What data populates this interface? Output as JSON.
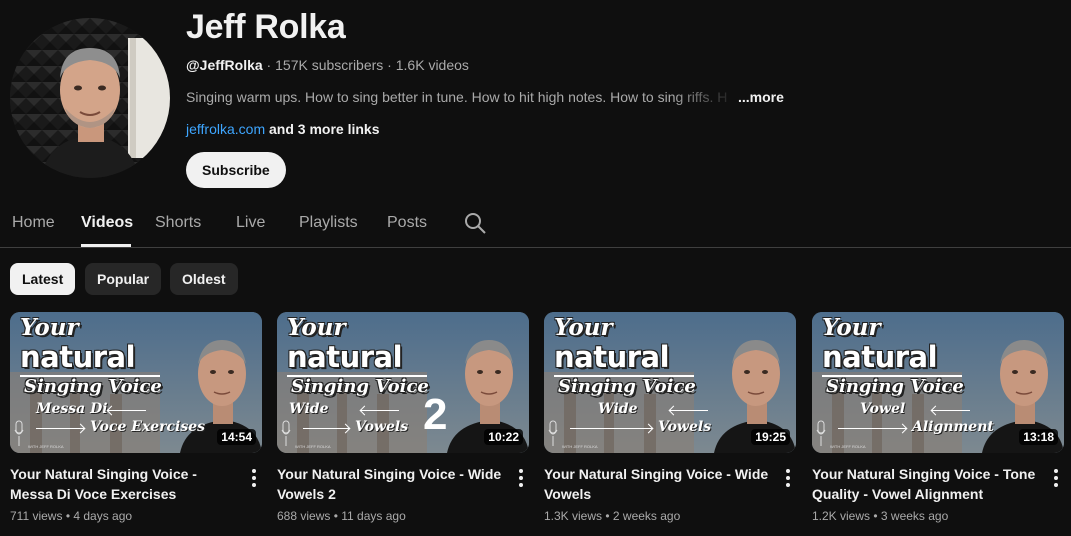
{
  "channel": {
    "name": "Jeff Rolka",
    "handle": "@JeffRolka",
    "subscribers": "157K subscribers",
    "videos_count": "1.6K videos",
    "separator": " · ",
    "description": "Singing warm ups.  How to sing better in tune.  How to hit high notes. How to sing riffs. H",
    "more_label": "...more",
    "link": "jeffrolka.com",
    "more_links": "and 3 more links",
    "subscribe_label": "Subscribe"
  },
  "tabs": [
    {
      "label": "Home"
    },
    {
      "label": "Videos"
    },
    {
      "label": "Shorts"
    },
    {
      "label": "Live"
    },
    {
      "label": "Playlists"
    },
    {
      "label": "Posts"
    }
  ],
  "active_tab": "Videos",
  "chips": [
    {
      "label": "Latest"
    },
    {
      "label": "Popular"
    },
    {
      "label": "Oldest"
    }
  ],
  "active_chip": "Latest",
  "thumbnail_text": {
    "your": "Your",
    "natural": "natural",
    "singing": "Singing Voice",
    "brand": "WITH JEFF ROLKA"
  },
  "videos": [
    {
      "title": "Your Natural Singing Voice - Messa Di Voce Exercises",
      "views": "711 views",
      "age": "4 days ago",
      "duration": "14:54",
      "thumb_line1": "Messa Di",
      "thumb_line2": "Voce Exercises",
      "thumb_big": ""
    },
    {
      "title": "Your Natural Singing Voice - Wide Vowels 2",
      "views": "688 views",
      "age": "11 days ago",
      "duration": "10:22",
      "thumb_line1": "Wide",
      "thumb_line2": "Vowels",
      "thumb_big": "2"
    },
    {
      "title": "Your Natural Singing Voice - Wide Vowels",
      "views": "1.3K views",
      "age": "2 weeks ago",
      "duration": "19:25",
      "thumb_line1": "Wide",
      "thumb_line2": "Vowels",
      "thumb_big": ""
    },
    {
      "title": "Your Natural Singing Voice - Tone Quality - Vowel Alignment",
      "views": "1.2K views",
      "age": "3 weeks ago",
      "duration": "13:18",
      "thumb_line1": "Vowel",
      "thumb_line2": "Alignment",
      "thumb_big": ""
    }
  ],
  "meta_separator": " • ",
  "colors": {
    "background": "#0f0f0f",
    "text_primary": "#f1f1f1",
    "text_secondary": "#aaaaaa",
    "link": "#3ea6ff",
    "chip_bg": "#272727"
  }
}
